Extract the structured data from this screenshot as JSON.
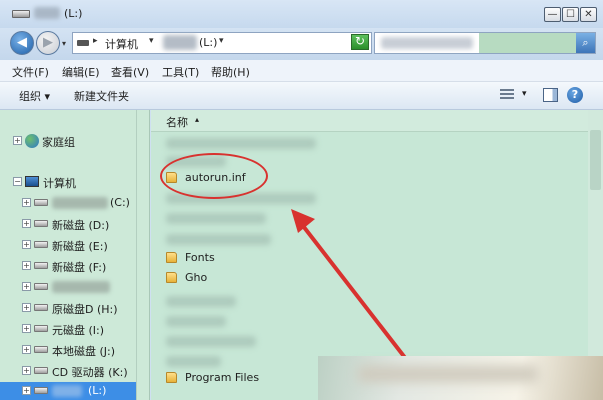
{
  "window": {
    "title": "(L:)",
    "buttons": {
      "minimize": "—",
      "maximize": "☐",
      "close": "✕"
    }
  },
  "address": {
    "crumbs": [
      "计算机",
      "(L:)"
    ],
    "refresh_icon": "refresh-icon",
    "search_icon": "magnifier-icon"
  },
  "menu": {
    "items": [
      "文件(F)",
      "编辑(E)",
      "查看(V)",
      "工具(T)",
      "帮助(H)"
    ]
  },
  "toolbar": {
    "organize": "组织 ▾",
    "new_folder": "新建文件夹",
    "help": "?"
  },
  "nav": {
    "homegroup": "家庭组",
    "computer": "计算机",
    "drives": [
      {
        "label": "(C:)"
      },
      {
        "label": "新磁盘 (D:)"
      },
      {
        "label": "新磁盘 (E:)"
      },
      {
        "label": "新磁盘 (F:)"
      },
      {
        "label": ""
      },
      {
        "label": "原磁盘D (H:)"
      },
      {
        "label": "元磁盘 (I:)"
      },
      {
        "label": "本地磁盘 (J:)"
      },
      {
        "label": "CD 驱动器 (K:)"
      },
      {
        "label": "(L:)"
      }
    ]
  },
  "files": {
    "column_name": "名称",
    "items": [
      "autorun.inf",
      "Fonts",
      "Gho",
      "Program Files"
    ]
  },
  "colors": {
    "pane_green": "#c7e7d6",
    "nav_green": "#cde9d8",
    "annotation_red": "#d8322f",
    "selected_blue": "#3d8ee6"
  }
}
